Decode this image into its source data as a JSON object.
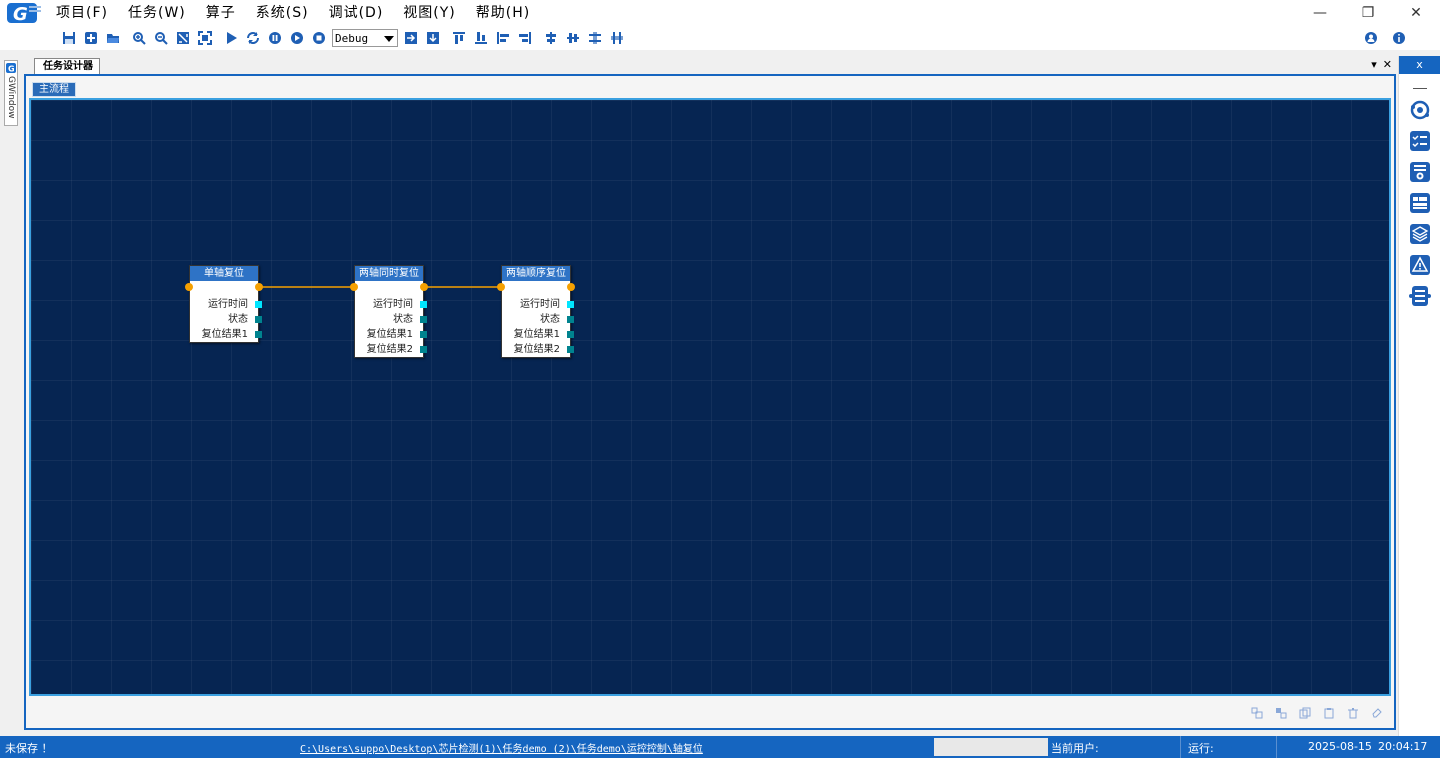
{
  "menu": [
    "项目(F)",
    "任务(W)",
    "算子",
    "系统(S)",
    "调试(D)",
    "视图(Y)",
    "帮助(H)"
  ],
  "window_controls": {
    "minimize": "—",
    "restore": "❐",
    "close": "✕"
  },
  "toolbar": {
    "mode": "Debug"
  },
  "left_tab": {
    "label": "GWindow"
  },
  "document": {
    "tab_label": "任务设计器",
    "tab_controls": [
      "▾",
      "✕"
    ],
    "flow_tab": "主流程"
  },
  "nodes": [
    {
      "title": "单轴复位",
      "ports": [
        {
          "label": "运行时间",
          "active": true
        },
        {
          "label": "状态",
          "active": false
        },
        {
          "label": "复位结果1",
          "active": false
        }
      ]
    },
    {
      "title": "两轴同时复位",
      "ports": [
        {
          "label": "运行时间",
          "active": true
        },
        {
          "label": "状态",
          "active": false
        },
        {
          "label": "复位结果1",
          "active": false
        },
        {
          "label": "复位结果2",
          "active": false
        }
      ]
    },
    {
      "title": "两轴顺序复位",
      "ports": [
        {
          "label": "运行时间",
          "active": true
        },
        {
          "label": "状态",
          "active": false
        },
        {
          "label": "复位结果1",
          "active": false
        },
        {
          "label": "复位结果2",
          "active": false
        }
      ]
    }
  ],
  "right_panel": {
    "close": "x",
    "icons": [
      "orbit-icon",
      "checklist-icon",
      "settings-list-icon",
      "table-icon",
      "layers-icon",
      "warning-icon",
      "flow-list-icon"
    ]
  },
  "status": {
    "save_state": "未保存 ！",
    "path": "C:\\Users\\suppo\\Desktop\\芯片检测(1)\\任务demo (2)\\任务demo\\运控控制\\轴复位",
    "user_label": "当前用户:",
    "run_label": "运行:",
    "date": "2025-08-15",
    "time": "20:04:17"
  },
  "colors": {
    "canvas_bg": "#062552",
    "accent": "#1565c0",
    "node_header": "#2e73c6",
    "link": "#f5a000",
    "port_active": "#00e5ff",
    "port": "#00838f"
  }
}
